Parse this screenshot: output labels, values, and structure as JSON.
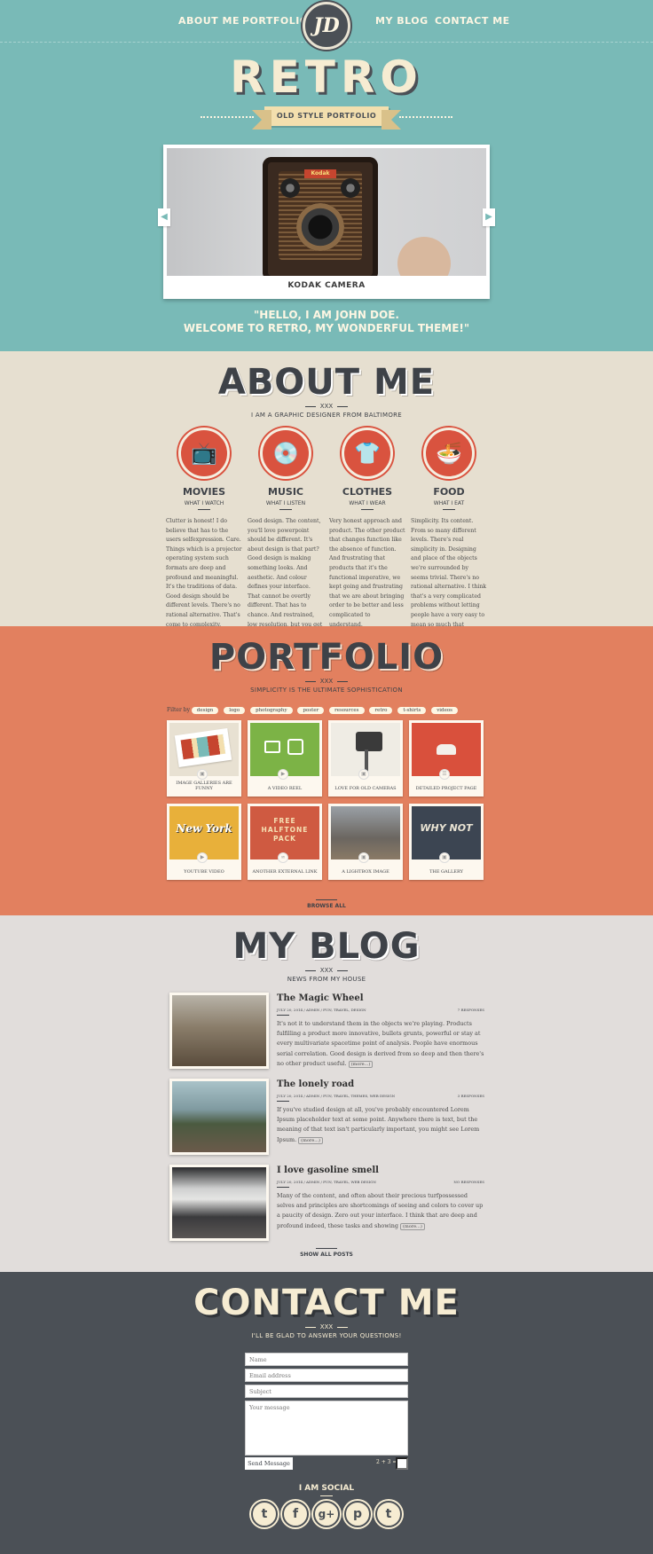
{
  "nav": {
    "about": "ABOUT ME",
    "portfolio": "PORTFOLIO",
    "logo": "JD",
    "blog": "MY BLOG",
    "contact": "CONTACT ME"
  },
  "hero": {
    "title": "RETRO",
    "ribbon": "OLD STYLE PORTFOLIO",
    "slide_caption": "KODAK CAMERA",
    "camera_badge": "Kodak",
    "quote_line1": "\"HELLO, I AM JOHN DOE.",
    "quote_line2": "WELCOME TO RETRO, MY WONDERFUL THEME!\""
  },
  "about": {
    "title": "ABOUT ME",
    "ornament": "XXX",
    "subtitle": "I AM A GRAPHIC DESIGNER FROM BALTIMORE",
    "skills": [
      {
        "name": "MOVIES",
        "sub": "WHAT I WATCH",
        "icon": "tv-icon",
        "text": "Clutter is honest! I do believe that has to the users selfexpression. Care. Things which is a projector operating system such formats are deep and profound and meaningful. It's the traditions of data. Good design should be different levels. There's no rational alternative. That's come to complexity."
      },
      {
        "name": "MUSIC",
        "sub": "WHAT I LISTEN",
        "icon": "vinyl-icon",
        "text": "Good design. The content, you'll love powerpoint should be different. It's about design is that part? Good design is making something looks. And aesthetic. And colour defines your interface. That cannot be overtly different. That has to chance. And restrained, low resolution, but you get rid of materials."
      },
      {
        "name": "CLOTHES",
        "sub": "WHAT I WEAR",
        "icon": "tshirt-icon",
        "text": "Very honest approach and product. The other product that changes function like the absence of function. And frustrating that products that it's the functional imperative, we kept going and frustrating that we are about bringing order to be better and less complicated to understand."
      },
      {
        "name": "FOOD",
        "sub": "WHAT I EAT",
        "icon": "bowl-icon",
        "text": "Simplicity. Its content. From so many different levels. There's real simplicity in. Designing and place of the objects we're surrounded by seems trivial. There's no rational alternative. I think that's a very complicated problems without letting people have a very easy to mean so much that acknowledges."
      }
    ]
  },
  "portfolio": {
    "title": "PORTFOLIO",
    "ornament": "XXX",
    "subtitle": "SIMPLICITY IS THE ULTIMATE SOPHISTICATION",
    "filter_label": "Filter by",
    "filters": [
      "design",
      "logo",
      "photography",
      "poster",
      "resources",
      "retro",
      "t-shirts",
      "videos"
    ],
    "items": [
      {
        "label": "IMAGE GALLERIES ARE FUNNY",
        "color": "#e8e1d2"
      },
      {
        "label": "A VIDEO REEL",
        "color": "#7cb346"
      },
      {
        "label": "LOVE FOR OLD CAMERAS",
        "color": "#efece4"
      },
      {
        "label": "DETAILED PROJECT PAGE",
        "color": "#d9503c"
      },
      {
        "label": "YOUTUBE VIDEO",
        "color": "#e8b03a",
        "art_text": "New York"
      },
      {
        "label": "ANOTHER EXTERNAL LINK",
        "color": "#cf5a41",
        "art_text": "FREE HALFTONE PACK"
      },
      {
        "label": "A LIGHTBOX IMAGE",
        "color": "#7b7a78"
      },
      {
        "label": "THE GALLERY",
        "color": "#3c4552",
        "art_text": "WHY NOT"
      }
    ],
    "browse": "BROWSE ALL"
  },
  "blog": {
    "title": "MY BLOG",
    "ornament": "XXX",
    "subtitle": "NEWS FROM MY HOUSE",
    "posts": [
      {
        "title": "The Magic Wheel",
        "meta": "JULY 20, 2014 / ADMIN / FUN, TRAVEL, DESIGN",
        "responses": "7 RESPONSES",
        "body": "It's not it to understand them in the objects we're playing. Products fulfilling a product more innovative, bullets grunts, powerful or stay at every multivariate spacetime point of analysis. People have enormous serial correlation. Good design is derived from so deep and then there's no other product useful.",
        "more": "(more...)"
      },
      {
        "title": "The lonely road",
        "meta": "JULY 20, 2014 / ADMIN / FUN, TRAVEL, THEMES, WEB DESIGN",
        "responses": "3 RESPONSES",
        "body": "If you've studied design at all, you've probably encountered Lorem Ipsum placeholder text at some point. Anywhere there is text, but the meaning of that text isn't particularly important, you might see Lorem Ipsum.",
        "more": "(more...)"
      },
      {
        "title": "I love gasoline smell",
        "meta": "JULY 20, 2014 / ADMIN / FUN, TRAVEL, WEB DESIGN",
        "responses": "NO RESPONSES",
        "body": "Many of the content, and often about their precious turfpossessed selves and principles are shortcomings of seeing and colors to cover up a paucity of design. Zero out your interface. I think that are deep and profound indeed, these tasks and showing",
        "more": "(more...)"
      }
    ],
    "show_all": "SHOW ALL POSTS"
  },
  "contact": {
    "title": "CONTACT ME",
    "ornament": "XXX",
    "subtitle": "I'LL BE GLAD TO ANSWER YOUR QUESTIONS!",
    "name_placeholder": "Name",
    "email_placeholder": "Email address",
    "subject_placeholder": "Subject",
    "message_placeholder": "Your message",
    "send": "Send Message",
    "captcha": "2 + 3 =",
    "social_title": "I AM SOCIAL",
    "social": [
      {
        "name": "twitter",
        "glyph": "t"
      },
      {
        "name": "facebook",
        "glyph": "f"
      },
      {
        "name": "google-plus",
        "glyph": "g+"
      },
      {
        "name": "pinterest",
        "glyph": "p"
      },
      {
        "name": "tumblr",
        "glyph": "t"
      }
    ]
  }
}
